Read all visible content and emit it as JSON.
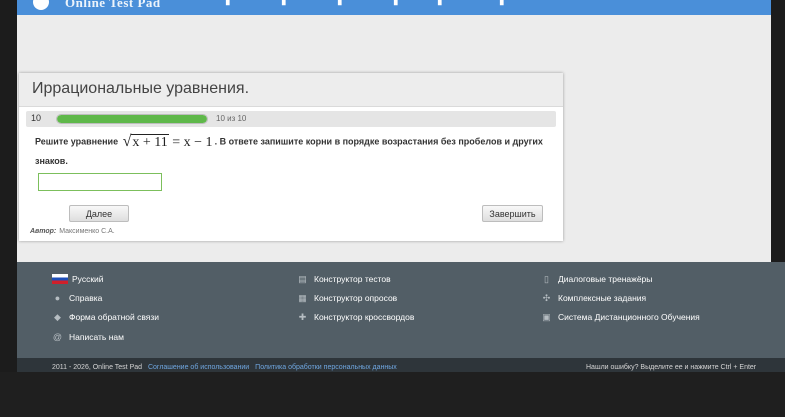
{
  "topbar": {
    "brand": "Online Test Pad"
  },
  "card": {
    "title": "Иррациональные уравнения.",
    "question_number": "10",
    "progress_text": "10 из 10",
    "progress_fraction": 1.0,
    "question_prefix": "Решите уравнение",
    "formula": {
      "radicand": "x + 11",
      "rhs": "= x − 1"
    },
    "question_suffix": ". В ответе запишите корни в порядке возрастания без пробелов и других знаков.",
    "answer_value": "",
    "next_button": "Далее",
    "finish_button": "Завершить",
    "author_label": "Автор:",
    "author_name": "Максименко С.А."
  },
  "footer": {
    "col1": [
      {
        "label": "Русский",
        "icon": "russia-flag-icon"
      },
      {
        "label": "Справка",
        "icon": "info-icon"
      },
      {
        "label": "Форма обратной связи",
        "icon": "chat-icon"
      },
      {
        "label": "Написать нам",
        "icon": "at-sign-icon"
      }
    ],
    "col2": [
      {
        "label": "Конструктор тестов",
        "icon": "document-icon"
      },
      {
        "label": "Конструктор опросов",
        "icon": "survey-icon"
      },
      {
        "label": "Конструктор кроссвордов",
        "icon": "crossword-icon"
      }
    ],
    "col3": [
      {
        "label": "Диалоговые тренажёры",
        "icon": "clipboard-icon"
      },
      {
        "label": "Комплексные задания",
        "icon": "puzzle-icon"
      },
      {
        "label": "Система Дистанционного Обучения",
        "icon": "grid-icon"
      }
    ],
    "copyright": "2011 - 2026, Online Test Pad",
    "link_agreement": "Соглашение об использовании",
    "link_privacy": "Политика обработки персональных данных",
    "error_hint": "Нашли ошибку? Выделите ее и нажмите Ctrl + Enter"
  }
}
